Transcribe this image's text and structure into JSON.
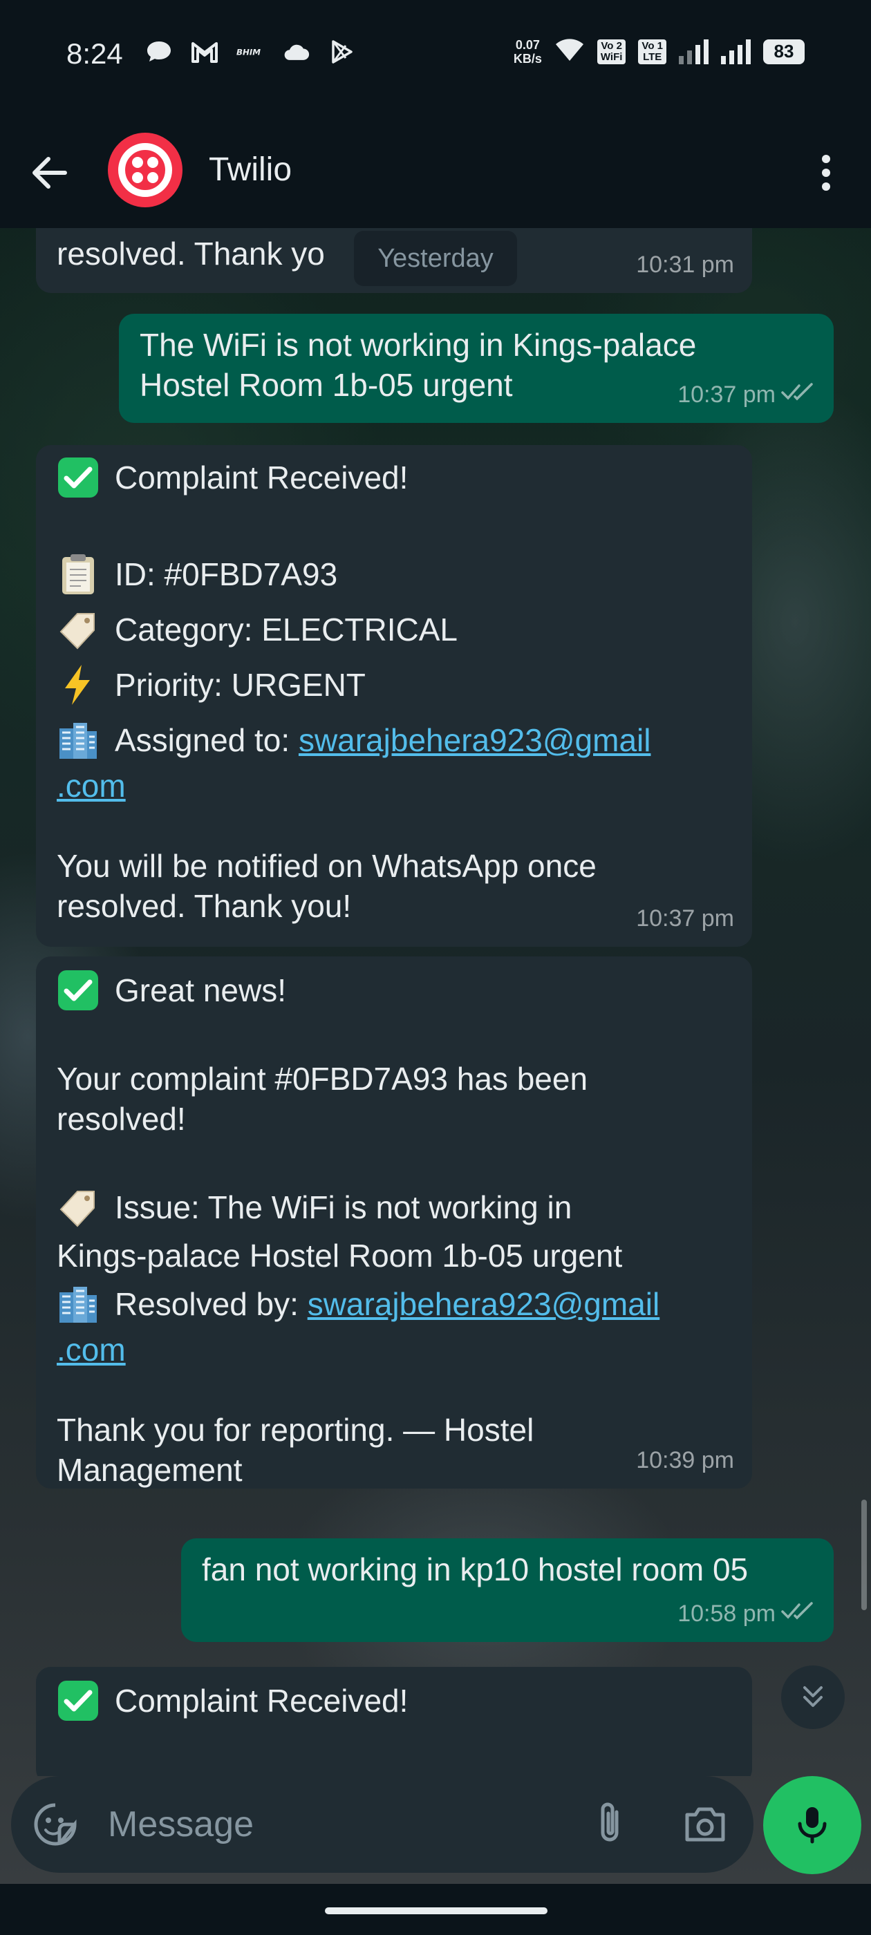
{
  "status_bar": {
    "time": "8:24",
    "net_speed_value": "0.07",
    "net_speed_unit": "KB/s",
    "sim1_label_top": "Vo 2",
    "sim1_label_bottom": "WiFi",
    "sim2_label_top": "Vo 1",
    "sim2_label_bottom": "LTE",
    "battery": "83"
  },
  "header": {
    "contact_name": "Twilio",
    "brand_color": "#f22f46"
  },
  "date_chip": "Yesterday",
  "messages": [
    {
      "direction": "in",
      "partial_text": "resolved. Thank yo",
      "time": "10:31 pm"
    },
    {
      "direction": "out",
      "lines": [
        "The WiFi is not working in Kings-palace",
        "Hostel Room 1b-05 urgent"
      ],
      "time": "10:37 pm"
    },
    {
      "direction": "in",
      "title": "Complaint Received!",
      "id_line": "ID: #0FBD7A93",
      "category_line": "Category: ELECTRICAL",
      "priority_line": "Priority: URGENT",
      "assigned_prefix": "Assigned to: ",
      "assigned_link_1": "swarajbehera923@gmail",
      "assigned_link_2": ".com",
      "footer_1": "You will be notified on WhatsApp once",
      "footer_2": "resolved. Thank you!",
      "time": "10:37 pm"
    },
    {
      "direction": "in",
      "title": "Great news!",
      "resolved_1": "Your complaint #0FBD7A93 has been",
      "resolved_2": "resolved!",
      "issue_1": "Issue: The WiFi is not working in",
      "issue_2": "Kings-palace Hostel Room 1b-05 urgent",
      "resolved_by_prefix": "Resolved by: ",
      "resolved_by_link_1": "swarajbehera923@gmail",
      "resolved_by_link_2": ".com",
      "thanks_1": "Thank you for reporting. — Hostel",
      "thanks_2": "Management",
      "time": "10:39 pm"
    },
    {
      "direction": "out",
      "text": "fan not working in kp10 hostel room 05",
      "time": "10:58 pm"
    },
    {
      "direction": "in",
      "title": "Complaint Received!"
    }
  ],
  "composer": {
    "placeholder": "Message"
  },
  "colors": {
    "incoming_bubble": "#202c33",
    "outgoing_bubble": "#005c4b",
    "link": "#53bdeb",
    "mic_button": "#21c063"
  },
  "icons": [
    "back-arrow-icon",
    "menu-dots-icon",
    "check-box-emoji",
    "clipboard-emoji",
    "tag-emoji",
    "lightning-emoji",
    "building-emoji",
    "double-check-icon",
    "chevron-down-icon",
    "sticker-icon",
    "paperclip-icon",
    "camera-icon",
    "mic-icon"
  ]
}
